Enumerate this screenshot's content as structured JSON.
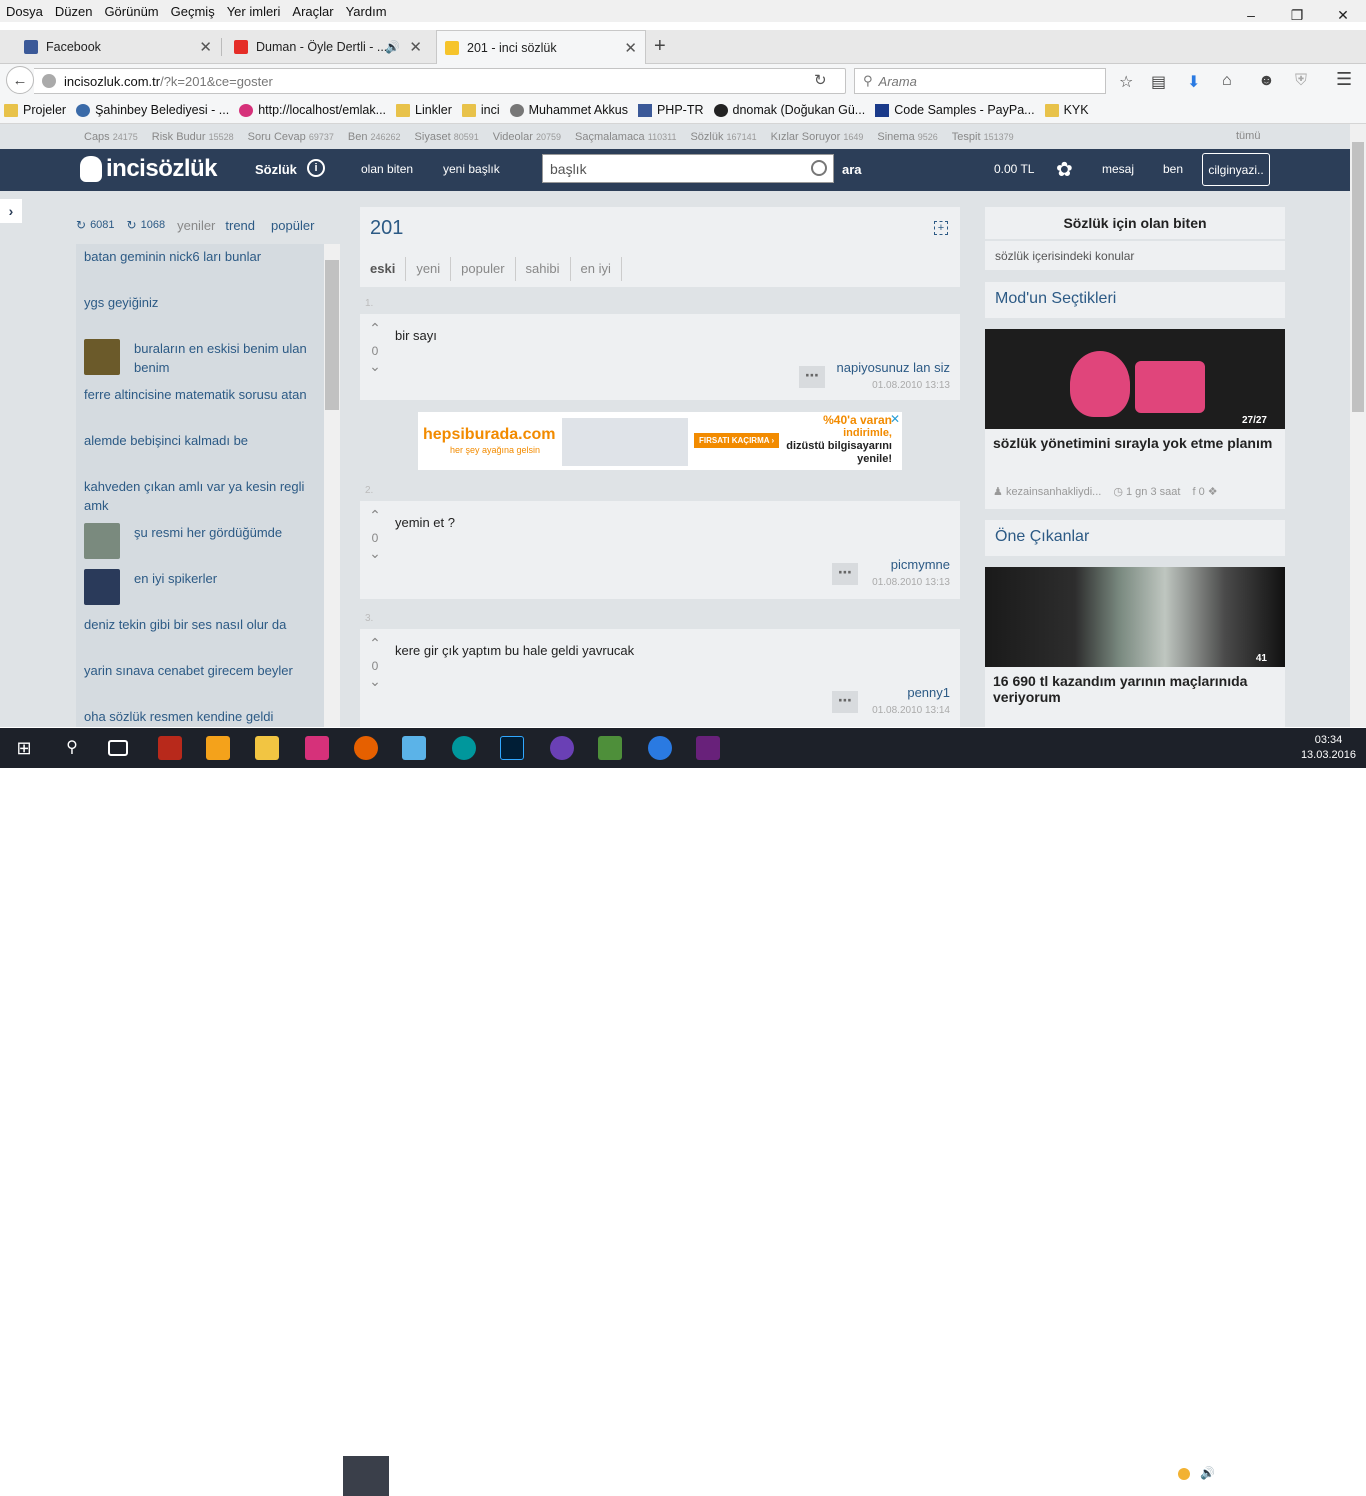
{
  "menubar": [
    "Dosya",
    "Düzen",
    "Görünüm",
    "Geçmiş",
    "Yer imleri",
    "Araçlar",
    "Yardım"
  ],
  "tabs": [
    {
      "title": "Facebook",
      "color": "#3b5998"
    },
    {
      "title": "Duman - Öyle Dertli - ...",
      "color": "#e52d27"
    },
    {
      "title": "201 - inci sözlük",
      "color": "#f6c42b"
    }
  ],
  "url": {
    "host": "incisozluk.com.tr",
    "path": "/?k=201&ce=goster"
  },
  "search": {
    "placeholder": "Arama"
  },
  "bookmarks": [
    "Projeler",
    "Şahinbey Belediyesi - ...",
    "http://localhost/emlak...",
    "Linkler",
    "inci",
    "Muhammet Akkus",
    "PHP-TR",
    "dnomak (Doğukan Gü...",
    "Code Samples - PayPa...",
    "KYK"
  ],
  "categories": [
    {
      "name": "Caps",
      "count": "24175"
    },
    {
      "name": "Risk Budur",
      "count": "15528"
    },
    {
      "name": "Soru Cevap",
      "count": "69737"
    },
    {
      "name": "Ben",
      "count": "246262"
    },
    {
      "name": "Siyaset",
      "count": "80591"
    },
    {
      "name": "Videolar",
      "count": "20759"
    },
    {
      "name": "Saçmalamaca",
      "count": "110311"
    },
    {
      "name": "Sözlük",
      "count": "167141"
    },
    {
      "name": "Kızlar Soruyor",
      "count": "1649"
    },
    {
      "name": "Sinema",
      "count": "9526"
    },
    {
      "name": "Tespit",
      "count": "151379"
    }
  ],
  "categories_all": "tümü",
  "header": {
    "logo": "incisözlük",
    "section": "Sözlük",
    "links": [
      "olan biten",
      "yeni başlık"
    ],
    "search_placeholder": "başlık",
    "search_btn": "ara",
    "balance": "0.00 TL",
    "mesaj": "mesaj",
    "ben": "ben",
    "user": "cilginyazi.."
  },
  "sidebar": {
    "count1": "6081",
    "count2": "1068",
    "tabs": [
      "yeniler",
      "trend",
      "popüler"
    ],
    "topics": [
      {
        "text": "batan geminin nick6 ları bunlar",
        "avatar": false
      },
      {
        "text": "ygs geyiğiniz",
        "avatar": false
      },
      {
        "text": "buraların en eskisi benim ulan benim",
        "avatar": true,
        "color": "#6b5a2a"
      },
      {
        "text": "ferre altincisine matematik sorusu atan",
        "avatar": false
      },
      {
        "text": "alemde bebişinci kalmadı be",
        "avatar": false
      },
      {
        "text": "kahveden çıkan amlı var ya kesin regli amk",
        "avatar": false
      },
      {
        "text": "şu resmi her gördüğümde",
        "avatar": true,
        "color": "#7a8a7e"
      },
      {
        "text": "en iyi spikerler",
        "avatar": true,
        "color": "#2a3a5a"
      },
      {
        "text": "deniz tekin gibi bir ses nasıl olur da",
        "avatar": false
      },
      {
        "text": "yarin sınava cenabet girecem beyler",
        "avatar": false
      },
      {
        "text": "oha sözlük resmen kendine geldi",
        "avatar": false
      }
    ]
  },
  "topic": {
    "title": "201",
    "tabs": [
      "eski",
      "yeni",
      "populer",
      "sahibi",
      "en iyi"
    ]
  },
  "entries": [
    {
      "num": "1.",
      "text": "bir sayı",
      "votes": "0",
      "author": "napiyosunuz lan siz",
      "date": "01.08.2010 13:13"
    },
    {
      "num": "2.",
      "text": "yemin et ?",
      "votes": "0",
      "author": "picmymne",
      "date": "01.08.2010 13:13"
    },
    {
      "num": "3.",
      "text": "kere gir çık yaptım bu hale geldi yavrucak",
      "votes": "0",
      "author": "penny1",
      "date": "01.08.2010 13:14"
    }
  ],
  "ad": {
    "brand": "hepsiburada.com",
    "slogan": "her şey ayağına gelsin",
    "cta": "FIRSATI KAÇIRMA ›",
    "offer1": "%40'a varan",
    "offer2": "indirimle,",
    "offer3": "dizüstü bilgisayarını",
    "offer4": "yenile!"
  },
  "right": {
    "olan_biten_title": "Sözlük için olan biten",
    "olan_biten_sub": "sözlük içerisindeki konular",
    "mod_title": "Mod'un Seçtikleri",
    "mod_img_counter": "27/27",
    "mod_caption": "sözlük yönetimini sırayla yok etme planım",
    "mod_author": "kezainsanhakliydi...",
    "mod_time": "1 gn 3 saat",
    "mod_fb": "0",
    "one_title": "Öne Çıkanlar",
    "one_counter": "41",
    "one_caption": "16 690 tl kazandım yarının maçlarınıda veriyorum"
  },
  "taskbar": {
    "time": "03:34",
    "date": "13.03.2016"
  }
}
